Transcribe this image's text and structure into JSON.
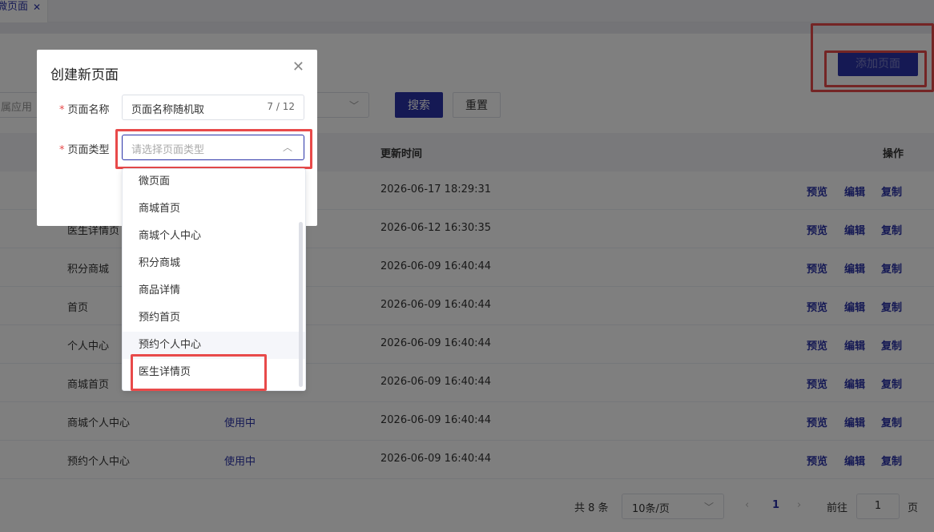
{
  "tabs": [
    {
      "label": "微页面",
      "close": "✕"
    }
  ],
  "filter": {
    "app_placeholder": "属应用",
    "search_label": "搜索",
    "reset_label": "重置"
  },
  "add_button_label": "添加页面",
  "table": {
    "headers": {
      "time": "更新时间",
      "action": "操作"
    },
    "rows": [
      {
        "name": "",
        "status": "",
        "time": "2026-06-17 18:29:31"
      },
      {
        "name": "医生详情页",
        "status": "",
        "time": "2026-06-12 16:30:35"
      },
      {
        "name": "积分商城",
        "status": "",
        "time": "2026-06-09 16:40:44"
      },
      {
        "name": "首页",
        "status": "",
        "time": "2026-06-09 16:40:44"
      },
      {
        "name": "个人中心",
        "status": "",
        "time": "2026-06-09 16:40:44"
      },
      {
        "name": "商城首页",
        "status": "",
        "time": "2026-06-09 16:40:44"
      },
      {
        "name": "商城个人中心",
        "status": "使用中",
        "time": "2026-06-09 16:40:44"
      },
      {
        "name": "预约个人中心",
        "status": "使用中",
        "time": "2026-06-09 16:40:44"
      }
    ],
    "actions": {
      "preview": "预览",
      "edit": "编辑",
      "copy": "复制"
    }
  },
  "pagination": {
    "total": "共 8 条",
    "page_size": "10条/页",
    "current": "1",
    "goto_label": "前往",
    "goto_value": "1",
    "page_unit": "页"
  },
  "dialog": {
    "title": "创建新页面",
    "name_label": "页面名称",
    "name_value": "页面名称随机取",
    "name_count": "7 / 12",
    "type_label": "页面类型",
    "type_placeholder": "请选择页面类型",
    "required_mark": "*"
  },
  "dropdown_options": [
    "微页面",
    "商城首页",
    "商城个人中心",
    "积分商城",
    "商品详情",
    "预约首页",
    "预约个人中心",
    "医生详情页"
  ],
  "colors": {
    "primary": "#2a33a8",
    "highlight": "#e84a4a"
  }
}
